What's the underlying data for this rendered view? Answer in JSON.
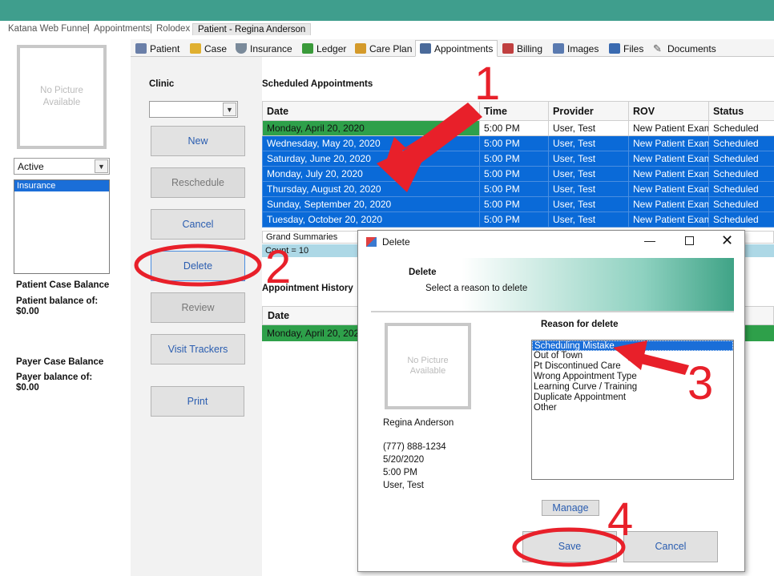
{
  "breadcrumb": [
    "Katana Web Funnel",
    "Appointments",
    "Rolodex",
    "Patient - Regina Anderson"
  ],
  "left": {
    "photo_text": "No Picture\nAvailable",
    "status_value": "Active",
    "list_items": [
      "Insurance"
    ],
    "patient_case_balance": "Patient Case Balance",
    "patient_balance_label": "Patient balance of:",
    "patient_balance_value": "$0.00",
    "payer_case_balance": "Payer Case Balance",
    "payer_balance_label": "Payer balance of:",
    "payer_balance_value": "$0.00"
  },
  "tabs": [
    {
      "label": "Patient",
      "icon": "id-card-icon",
      "color": "#6a7fa8"
    },
    {
      "label": "Case",
      "icon": "folder-icon",
      "color": "#e0b030"
    },
    {
      "label": "Insurance",
      "icon": "shield-icon",
      "color": "#7a8a9a"
    },
    {
      "label": "Ledger",
      "icon": "dollar-icon",
      "color": "#3a9a3a"
    },
    {
      "label": "Care Plan",
      "icon": "clipboard-icon",
      "color": "#d49a2a"
    },
    {
      "label": "Appointments",
      "icon": "calendar-icon",
      "color": "#4a6a9a"
    },
    {
      "label": "Billing",
      "icon": "spreadsheet-icon",
      "color": "#c04040"
    },
    {
      "label": "Images",
      "icon": "images-icon",
      "color": "#5a7ab0"
    },
    {
      "label": "Files",
      "icon": "files-icon",
      "color": "#3a6ab0"
    },
    {
      "label": "Documents",
      "icon": "pen-icon",
      "color": "#555555"
    }
  ],
  "clinic_label": "Clinic",
  "buttons": {
    "new": "New",
    "reschedule": "Reschedule",
    "cancel": "Cancel",
    "delete": "Delete",
    "review": "Review",
    "visit_trackers": "Visit Trackers",
    "print": "Print"
  },
  "scheduled": {
    "title": "Scheduled Appointments",
    "columns": [
      "Date",
      "Time",
      "Provider",
      "ROV",
      "Status"
    ],
    "rows": [
      [
        "Monday, April 20, 2020",
        "5:00 PM",
        "User, Test",
        "New Patient Exam",
        "Scheduled"
      ],
      [
        "Wednesday, May 20, 2020",
        "5:00 PM",
        "User, Test",
        "New Patient Exam",
        "Scheduled"
      ],
      [
        "Saturday, June 20, 2020",
        "5:00 PM",
        "User, Test",
        "New Patient Exam",
        "Scheduled"
      ],
      [
        "Monday, July 20, 2020",
        "5:00 PM",
        "User, Test",
        "New Patient Exam",
        "Scheduled"
      ],
      [
        "Thursday, August 20, 2020",
        "5:00 PM",
        "User, Test",
        "New Patient Exam",
        "Scheduled"
      ],
      [
        "Sunday, September 20, 2020",
        "5:00 PM",
        "User, Test",
        "New Patient Exam",
        "Scheduled"
      ],
      [
        "Tuesday, October 20, 2020",
        "5:00 PM",
        "User, Test",
        "New Patient Exam",
        "Scheduled"
      ]
    ],
    "grand_summaries": "Grand Summaries",
    "count": "Count = 10"
  },
  "history": {
    "title": "Appointment History",
    "columns": [
      "Date"
    ],
    "first_row": "Monday, April 20, 2020"
  },
  "dialog": {
    "title": "Delete",
    "header_title": "Delete",
    "header_sub": "Select a reason to delete",
    "photo_text": "No Picture\nAvailable",
    "patient_name": "Regina Anderson",
    "phone": "(777) 888-1234",
    "date": "5/20/2020",
    "time": "5:00 PM",
    "provider": "User, Test",
    "reason_label": "Reason for delete",
    "reasons": [
      "Scheduling Mistake",
      "Out of Town",
      "Pt Discontinued Care",
      "Wrong Appointment Type",
      "Learning Curve / Training",
      "Duplicate Appointment",
      "Other"
    ],
    "selected_reason": "Scheduling Mistake",
    "manage": "Manage",
    "save": "Save",
    "cancel": "Cancel"
  },
  "annotations": [
    "1",
    "2",
    "3",
    "4"
  ],
  "colors": {
    "teal": "#3f9e8d",
    "blue_row": "#0a6ad8",
    "green_row": "#2ea04a",
    "annotation_red": "#e8202a"
  }
}
